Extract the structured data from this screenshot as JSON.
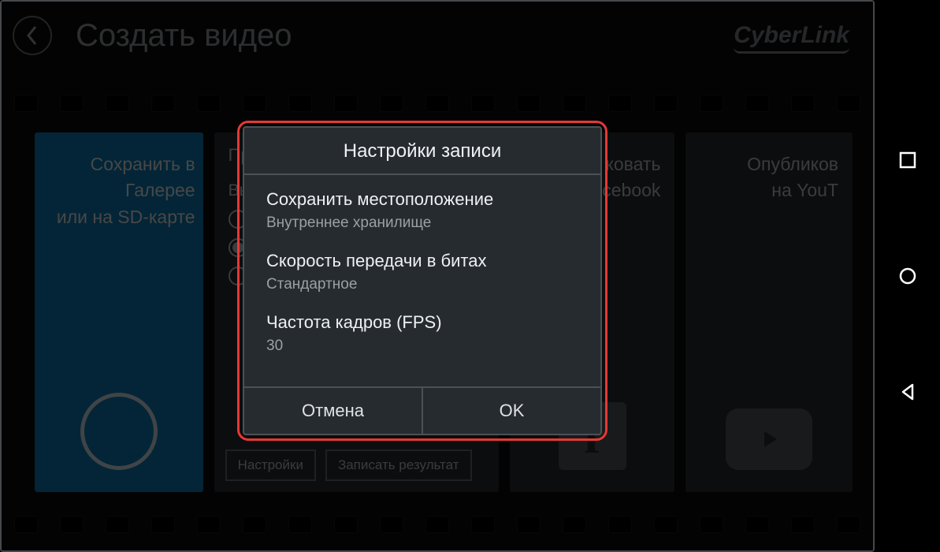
{
  "header": {
    "title": "Создать видео",
    "brand": "CyberLink"
  },
  "cards": {
    "gallery": {
      "line1": "Сохранить в",
      "line2": "Галерее",
      "line3": "или на SD-карте"
    },
    "export": {
      "profile_prefix": "Пр",
      "select_prefix": "Выб",
      "settings_btn": "Настройки",
      "record_btn": "Записать результат"
    },
    "facebook": {
      "line1": "ковать",
      "line2": "cebook"
    },
    "youtube": {
      "line1": "Опубликов",
      "line2": "на YouT"
    }
  },
  "dialog": {
    "title": "Настройки записи",
    "items": [
      {
        "label": "Сохранить местоположение",
        "value": "Внутреннее хранилище"
      },
      {
        "label": "Скорость передачи в битах",
        "value": "Стандартное"
      },
      {
        "label": "Частота кадров (FPS)",
        "value": "30"
      }
    ],
    "cancel": "Отмена",
    "ok": "OK"
  }
}
